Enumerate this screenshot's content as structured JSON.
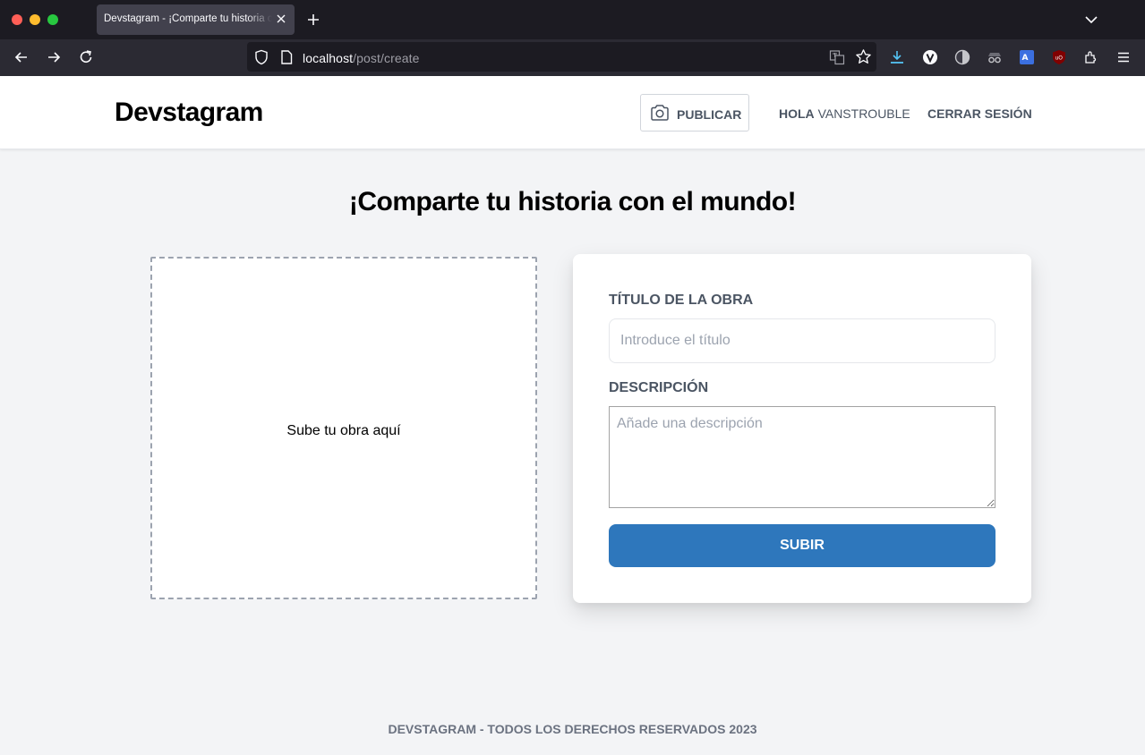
{
  "browser": {
    "tab_title": "Devstagram - ¡Comparte tu historia con el mundo!",
    "url_host": "localhost",
    "url_path": "/post/create"
  },
  "header": {
    "logo": "Devstagram",
    "publish_label": "PUBLICAR",
    "greeting": "HOLA",
    "username": "VANSTROUBLE",
    "logout_label": "CERRAR SESIÓN"
  },
  "main": {
    "heading": "¡Comparte tu historia con el mundo!",
    "dropzone_message": "Sube tu obra aquí",
    "form": {
      "title_label": "TÍTULO DE LA OBRA",
      "title_placeholder": "Introduce el título",
      "title_value": "",
      "description_label": "DESCRIPCIÓN",
      "description_placeholder": "Añade una descripción",
      "submit_label": "SUBIR"
    }
  },
  "footer": {
    "text": "DEVSTAGRAM - TODOS LOS DERECHOS RESERVADOS 2023"
  },
  "icons": {
    "publish": "camera-icon",
    "toolbar": [
      "back-icon",
      "forward-icon",
      "reload-icon",
      "shield-icon",
      "page-icon",
      "translate-icon",
      "bookmark-star-icon",
      "download-icon",
      "extension-v-icon",
      "extension-dark-icon",
      "extension-spy-icon",
      "extension-translate-icon",
      "ublock-icon",
      "extensions-icon",
      "menu-icon"
    ]
  },
  "colors": {
    "accent": "#2e77bc",
    "page_background": "#f3f4f6",
    "text_muted": "#4b5563"
  }
}
